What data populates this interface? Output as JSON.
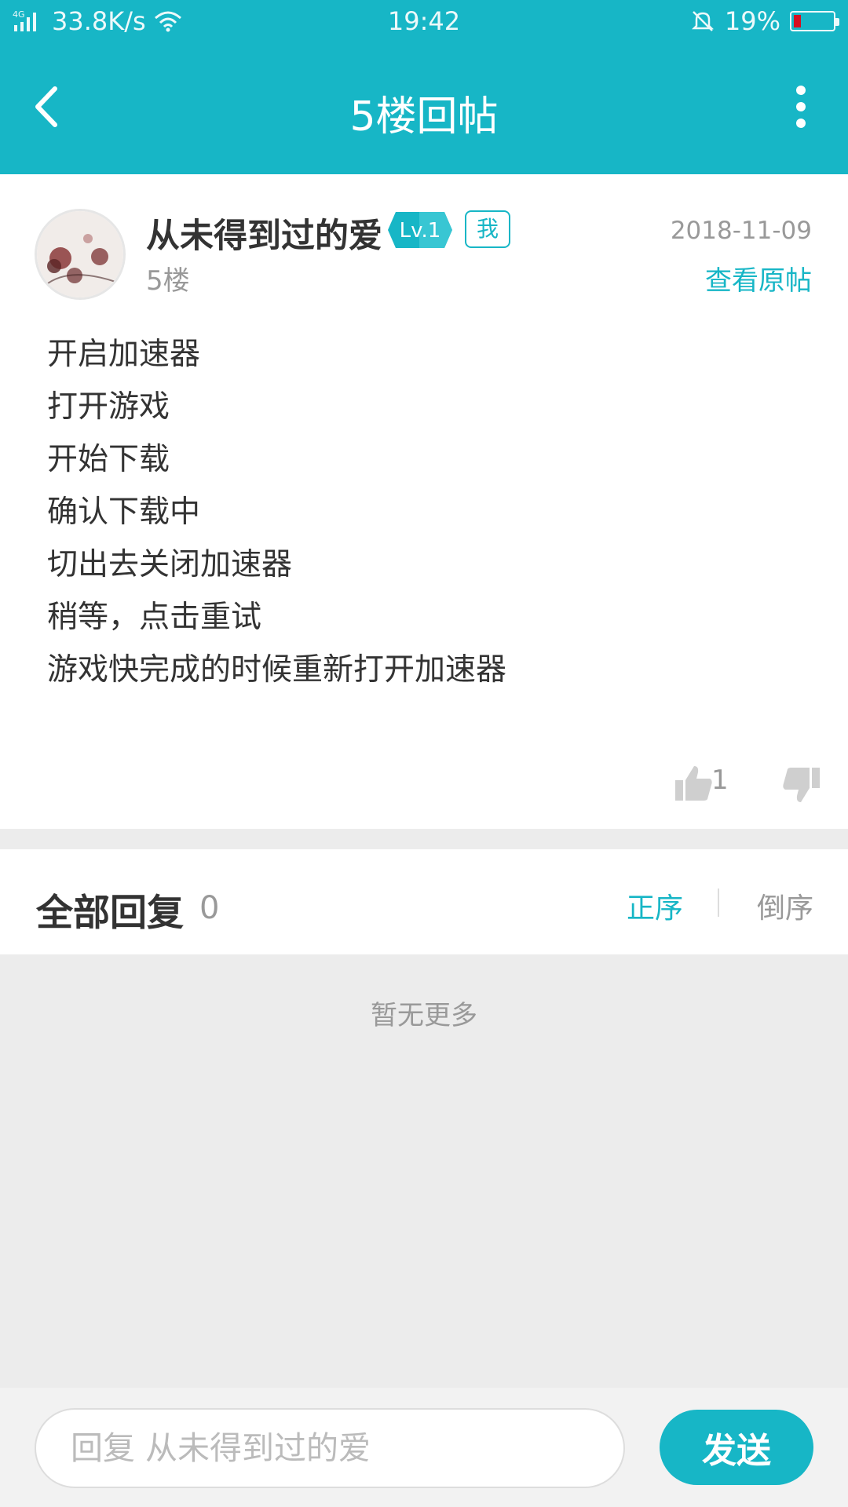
{
  "status_bar": {
    "network": "4G",
    "speed": "33.8K/s",
    "time": "19:42",
    "battery": "19%",
    "battery_level": 0.19,
    "battery_color": "#e60012"
  },
  "app_bar": {
    "title": "5楼回帖",
    "back_icon": "chevron-left-icon",
    "more_icon": "more-vertical-icon"
  },
  "post": {
    "username": "从未得到过的爱",
    "level": "Lv.1",
    "me_tag": "我",
    "floor": "5楼",
    "date": "2018-11-09",
    "view_original": "查看原帖",
    "content_lines": [
      "开启加速器",
      "打开游戏",
      "开始下载",
      "确认下载中",
      "切出去关闭加速器",
      "稍等，点击重试",
      "游戏快完成的时候重新打开加速器"
    ],
    "like_count": "1"
  },
  "replies": {
    "title": "全部回复",
    "count": "0",
    "sort_asc": "正序",
    "sort_desc": "倒序",
    "empty_text": "暂无更多"
  },
  "reply_bar": {
    "placeholder": "回复 从未得到过的爱",
    "send_label": "发送"
  },
  "colors": {
    "accent": "#17b6c6",
    "background": "#ececec"
  }
}
